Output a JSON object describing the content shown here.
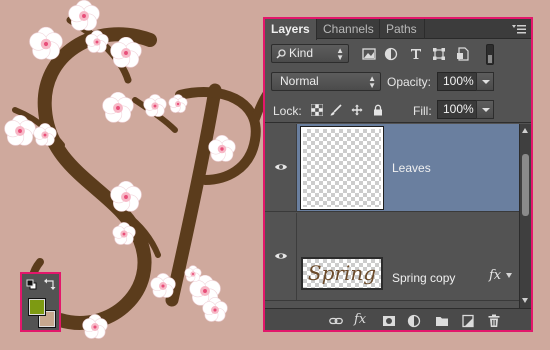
{
  "colors": {
    "canvas_bg": "#cfa99d",
    "branch": "#5b3c1c",
    "blossom": "#ffffff",
    "blossom_center": "#e84f7a",
    "highlight_border": "#e3176b",
    "panel_bg": "#535353",
    "selected_row": "#6a7f9f",
    "foreground_color": "#7d9a12",
    "background_color": "#c6a78e"
  },
  "tools": {
    "icons": [
      "default-colors-icon",
      "swap-colors-icon"
    ]
  },
  "layers_panel": {
    "tabs": [
      {
        "label": "Layers",
        "active": true
      },
      {
        "label": "Channels",
        "active": false
      },
      {
        "label": "Paths",
        "active": false
      }
    ],
    "filter": {
      "kind_label": "Kind",
      "icons": [
        "pixel-filter-icon",
        "adjustment-filter-icon",
        "type-filter-icon",
        "shape-filter-icon",
        "smart-object-filter-icon"
      ]
    },
    "blend_mode": "Normal",
    "opacity_label": "Opacity:",
    "opacity_value": "100%",
    "lock_label": "Lock:",
    "lock_icons": [
      "lock-transparent-icon",
      "lock-image-icon",
      "lock-position-icon",
      "lock-all-icon"
    ],
    "fill_label": "Fill:",
    "fill_value": "100%",
    "layers": [
      {
        "name": "Leaves",
        "selected": true,
        "visible": true,
        "has_fx": false,
        "thumbnail": "transparent"
      },
      {
        "name": "Spring copy",
        "selected": false,
        "visible": true,
        "has_fx": true,
        "fx_label": "fx",
        "thumbnail": "Spring"
      }
    ],
    "footer_icons": [
      "link-layers-icon",
      "fx-icon",
      "layer-mask-icon",
      "adjustment-layer-icon",
      "group-folder-icon",
      "new-layer-icon",
      "trash-icon"
    ],
    "footer_fx_label": "fx"
  }
}
